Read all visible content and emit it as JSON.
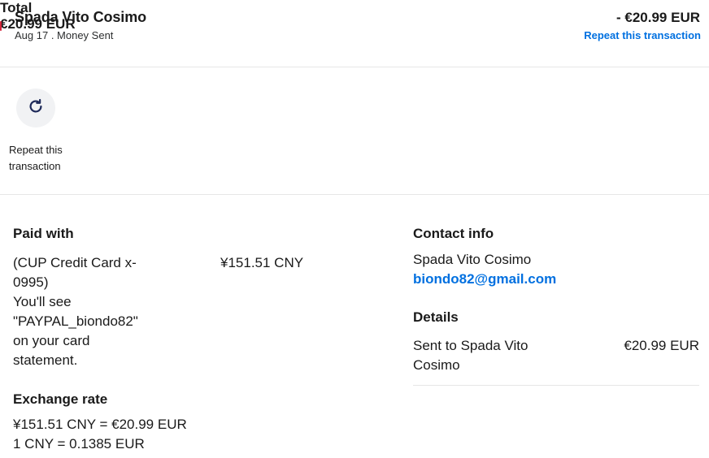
{
  "colors": {
    "accent_blue": "#0070e0",
    "accent_red": "#d4263b",
    "divider": "#e6e6e6",
    "icon_bg": "#f1f2f4"
  },
  "header": {
    "name": "Spada Vito Cosimo",
    "subtitle": "Aug 17 . Money Sent",
    "amount": "- €20.99 EUR",
    "repeat_link": "Repeat this transaction"
  },
  "actions": {
    "repeat": {
      "icon": "refresh-icon",
      "label_line1": "Repeat this",
      "label_line2": "transaction"
    }
  },
  "paid_with": {
    "heading": "Paid with",
    "line1": "(CUP Credit Card x-",
    "line2": "0995)",
    "line3": "You'll see",
    "line4": "\"PAYPAL_biondo82\"",
    "line5": "on your card",
    "line6": "statement.",
    "amount": "¥151.51 CNY"
  },
  "exchange_rate": {
    "heading": "Exchange rate",
    "line1": "¥151.51 CNY = €20.99 EUR",
    "line2": "1 CNY = 0.1385 EUR"
  },
  "contact_info": {
    "heading": "Contact info",
    "name": "Spada Vito Cosimo",
    "email": "biondo82@gmail.com"
  },
  "details": {
    "heading": "Details",
    "sent_to_line1": "Sent to Spada Vito",
    "sent_to_line2": "Cosimo",
    "sent_amount": "€20.99 EUR",
    "total_label": "Total",
    "total_amount": "€20.99 EUR"
  }
}
